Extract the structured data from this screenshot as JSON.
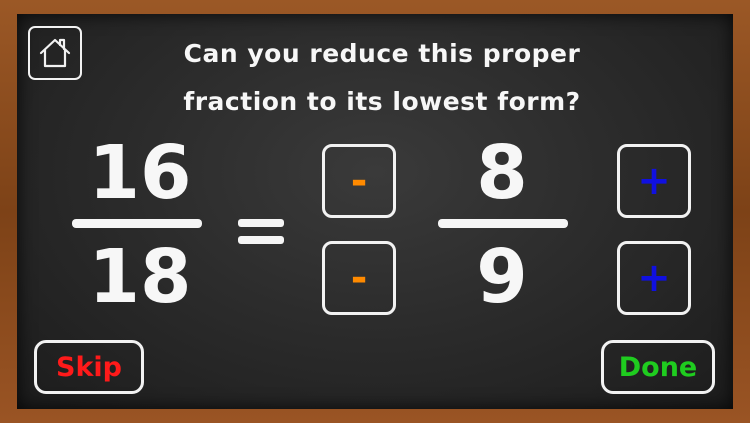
{
  "question": {
    "line1": "Can you reduce this proper",
    "line2": "fraction to its lowest form?"
  },
  "original_fraction": {
    "numerator": "16",
    "denominator": "18"
  },
  "equals_sign": "=",
  "answer_fraction": {
    "numerator": "8",
    "denominator": "9"
  },
  "controls": {
    "minus_label": "-",
    "plus_label": "+",
    "skip_label": "Skip",
    "done_label": "Done"
  },
  "icons": {
    "home": "home-icon"
  },
  "colors": {
    "chalk": "#f7f7f7",
    "minus": "#ff8a00",
    "plus": "#1010e0",
    "skip": "#ff1a1a",
    "done": "#1fcc1f",
    "frame": "#8a4a1c",
    "board": "#2c2c2c"
  }
}
